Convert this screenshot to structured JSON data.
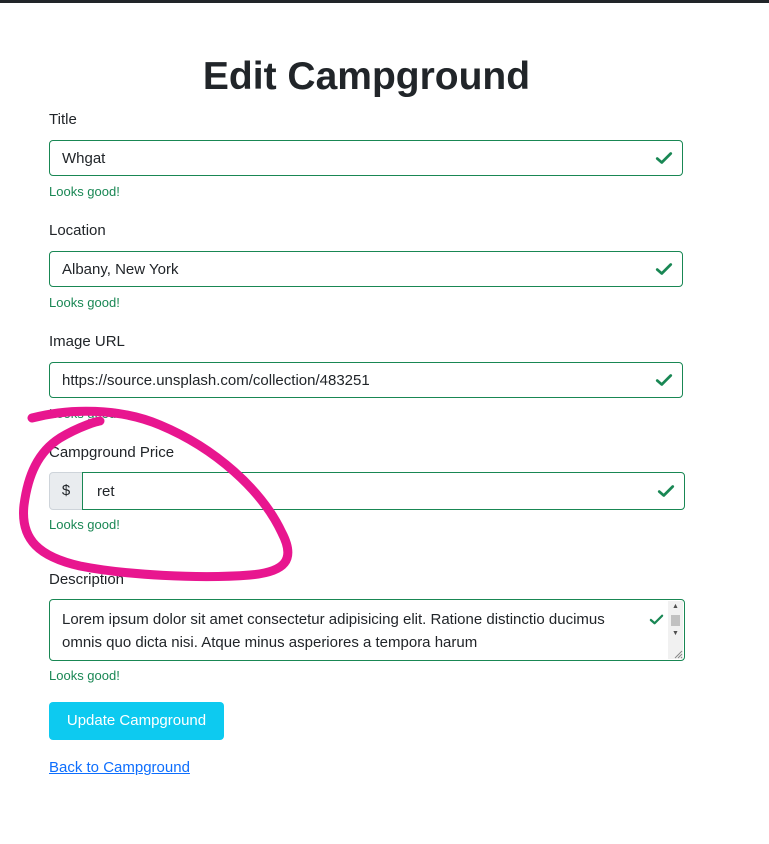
{
  "page": {
    "heading": "Edit Campground"
  },
  "form": {
    "title": {
      "label": "Title",
      "value": "Whgat",
      "feedback": "Looks good!"
    },
    "location": {
      "label": "Location",
      "value": "Albany, New York",
      "feedback": "Looks good!"
    },
    "image": {
      "label": "Image URL",
      "value": "https://source.unsplash.com/collection/483251",
      "feedback": "Looks good!"
    },
    "price": {
      "label": "Campground Price",
      "prefix": "$",
      "value": "ret",
      "feedback": "Looks good!"
    },
    "description": {
      "label": "Description",
      "value": "Lorem ipsum dolor sit amet consectetur adipisicing elit. Ratione distinctio ducimus omnis quo dicta nisi. Atque minus asperiores a tempora harum",
      "feedback": "Looks good!"
    },
    "submit_label": "Update Campground"
  },
  "back_link": "Back to Campground",
  "colors": {
    "valid": "#198754",
    "button": "#0dcaf0",
    "link": "#0d6efd",
    "annotation": "#e8168f"
  },
  "icons": {
    "valid": "check-icon",
    "resize": "resize-handle-icon"
  }
}
